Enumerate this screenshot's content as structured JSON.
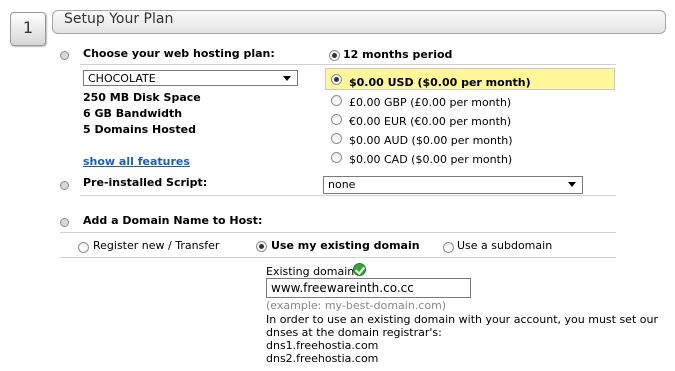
{
  "step": {
    "number": "1",
    "title": "Setup Your Plan"
  },
  "plan": {
    "label": "Choose your web hosting plan:",
    "selected": "CHOCOLATE",
    "features": [
      "250 MB Disk Space",
      "6 GB Bandwidth",
      "5 Domains Hosted"
    ],
    "show_all": "show all features"
  },
  "period": {
    "label": "12 months period",
    "prices": [
      "$0.00 USD ($0.00 per month)",
      "£0.00 GBP (£0.00 per month)",
      "€0.00 EUR (€0.00 per month)",
      "$0.00 AUD ($0.00 per month)",
      "$0.00 CAD ($0.00 per month)"
    ]
  },
  "script": {
    "label": "Pre-installed Script:",
    "selected": "none"
  },
  "domain": {
    "label": "Add a Domain Name to Host:",
    "options": [
      "Register new / Transfer",
      "Use my existing domain",
      "Use a subdomain"
    ],
    "existing_label": "Existing domain:",
    "value": "www.freewareinth.co.cc",
    "example": "(example: my-best-domain.com)",
    "note_1": "In order to use an existing domain with your account, you must set our",
    "note_2": "dnses at the domain registrar's:",
    "dns1": "dns1.freehostia.com",
    "dns2": "dns2.freehostia.com"
  },
  "colors": {
    "highlight": "#fff79a",
    "link": "#1b5fb3",
    "check": "#3aa63a"
  }
}
